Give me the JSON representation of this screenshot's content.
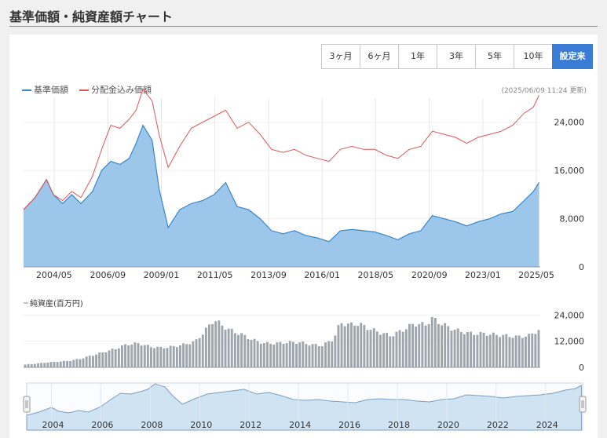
{
  "page": {
    "title": "基準価額・純資産額チャート"
  },
  "buttons": [
    {
      "label": "3ヶ月",
      "active": false
    },
    {
      "label": "6ヶ月",
      "active": false
    },
    {
      "label": "1年",
      "active": false
    },
    {
      "label": "3年",
      "active": false
    },
    {
      "label": "5年",
      "active": false
    },
    {
      "label": "10年",
      "active": false
    },
    {
      "label": "設定来",
      "active": true
    }
  ],
  "legend": {
    "nav": "基準価額",
    "reinvest": "分配金込み価額"
  },
  "updated": "(2025/06/09 11:24 更新)",
  "colors": {
    "nav_line": "#3a86c8",
    "nav_fill": "#9cc7ea",
    "reinvest_line": "#e05555",
    "bar": "#9ea6ad",
    "navigator_fill": "#cfe3f3"
  },
  "chart_data": [
    {
      "type": "area",
      "x_ticks": [
        "2004/05",
        "2006/09",
        "2009/01",
        "2011/05",
        "2013/09",
        "2016/01",
        "2018/05",
        "2020/09",
        "2023/01",
        "2025/05"
      ],
      "y_ticks": [
        "0",
        "8,000",
        "16,000",
        "24,000"
      ],
      "ylim": [
        0,
        28000
      ],
      "x_range": [
        2003.0,
        2025.5
      ],
      "series": [
        {
          "name": "基準価額",
          "x": [
            2003.0,
            2003.5,
            2004.0,
            2004.3,
            2004.7,
            2005.1,
            2005.5,
            2006.0,
            2006.4,
            2006.8,
            2007.2,
            2007.6,
            2007.9,
            2008.2,
            2008.6,
            2008.9,
            2009.3,
            2009.8,
            2010.3,
            2010.8,
            2011.3,
            2011.8,
            2012.3,
            2012.8,
            2013.3,
            2013.8,
            2014.3,
            2014.8,
            2015.3,
            2015.8,
            2016.3,
            2016.8,
            2017.3,
            2017.8,
            2018.3,
            2018.8,
            2019.3,
            2019.8,
            2020.3,
            2020.8,
            2021.3,
            2021.8,
            2022.3,
            2022.8,
            2023.3,
            2023.8,
            2024.3,
            2024.8,
            2025.2,
            2025.45
          ],
          "values": [
            9500,
            11500,
            14500,
            12000,
            10500,
            12000,
            10500,
            12500,
            16000,
            17500,
            17000,
            18000,
            20500,
            23500,
            21000,
            13000,
            6500,
            9500,
            10500,
            11000,
            12000,
            14000,
            10000,
            9500,
            8000,
            6000,
            5500,
            6000,
            5200,
            4800,
            4200,
            6000,
            6200,
            6000,
            5800,
            5200,
            4500,
            5500,
            6000,
            8500,
            8000,
            7500,
            6800,
            7500,
            8000,
            8800,
            9200,
            11000,
            12500,
            14000
          ]
        },
        {
          "name": "分配金込み価額",
          "x": [
            2003.0,
            2003.5,
            2004.0,
            2004.3,
            2004.7,
            2005.1,
            2005.5,
            2006.0,
            2006.4,
            2006.8,
            2007.2,
            2007.6,
            2007.9,
            2008.2,
            2008.6,
            2008.9,
            2009.3,
            2009.8,
            2010.3,
            2010.8,
            2011.3,
            2011.8,
            2012.3,
            2012.8,
            2013.3,
            2013.8,
            2014.3,
            2014.8,
            2015.3,
            2015.8,
            2016.3,
            2016.8,
            2017.3,
            2017.8,
            2018.3,
            2018.8,
            2019.3,
            2019.8,
            2020.3,
            2020.8,
            2021.3,
            2021.8,
            2022.3,
            2022.8,
            2023.3,
            2023.8,
            2024.3,
            2024.8,
            2025.2,
            2025.45
          ],
          "values": [
            9500,
            11500,
            14500,
            12000,
            11000,
            12500,
            11500,
            15000,
            19500,
            23500,
            23000,
            24500,
            26000,
            29500,
            27500,
            22000,
            16500,
            20000,
            23000,
            24000,
            25000,
            26000,
            23000,
            24000,
            22000,
            19500,
            19000,
            19500,
            18500,
            18000,
            17500,
            19500,
            20000,
            19500,
            19500,
            18500,
            18000,
            19500,
            20000,
            22500,
            22000,
            21500,
            20500,
            21500,
            22000,
            22500,
            23500,
            25500,
            26500,
            28500
          ]
        }
      ]
    },
    {
      "type": "bar",
      "title": "純資産(百万円)",
      "y_ticks": [
        "0",
        "12,000",
        "24,000"
      ],
      "ylim": [
        0,
        27000
      ],
      "x_range": [
        2003.0,
        2025.5
      ],
      "x": [
        2003.0,
        2004.0,
        2005.0,
        2005.5,
        2006.0,
        2006.5,
        2007.0,
        2007.5,
        2008.0,
        2008.5,
        2009.0,
        2009.5,
        2010.0,
        2010.5,
        2011.0,
        2011.3,
        2011.6,
        2012.0,
        2012.5,
        2013.0,
        2013.5,
        2014.0,
        2014.5,
        2015.0,
        2015.5,
        2016.0,
        2016.5,
        2016.8,
        2017.2,
        2017.6,
        2018.0,
        2018.5,
        2019.0,
        2019.5,
        2020.0,
        2020.5,
        2020.8,
        2021.2,
        2021.6,
        2022.0,
        2022.5,
        2023.0,
        2023.5,
        2024.0,
        2024.5,
        2025.0,
        2025.4
      ],
      "values": [
        1200,
        2200,
        3000,
        4000,
        5500,
        7000,
        8500,
        10500,
        11000,
        9500,
        9000,
        9500,
        10500,
        12000,
        18000,
        22000,
        19500,
        17000,
        15000,
        12500,
        11000,
        11000,
        11500,
        11500,
        10500,
        10000,
        13000,
        20500,
        19500,
        20000,
        18000,
        16000,
        14500,
        17000,
        20000,
        19500,
        22500,
        20000,
        18000,
        16500,
        15500,
        15500,
        15000,
        14500,
        14000,
        14500,
        17000
      ]
    },
    {
      "type": "area",
      "role": "navigator",
      "x_ticks": [
        "2004",
        "2006",
        "2008",
        "2010",
        "2012",
        "2014",
        "2016",
        "2018",
        "2020",
        "2022",
        "2024"
      ],
      "x_range": [
        2003.0,
        2025.5
      ]
    }
  ]
}
